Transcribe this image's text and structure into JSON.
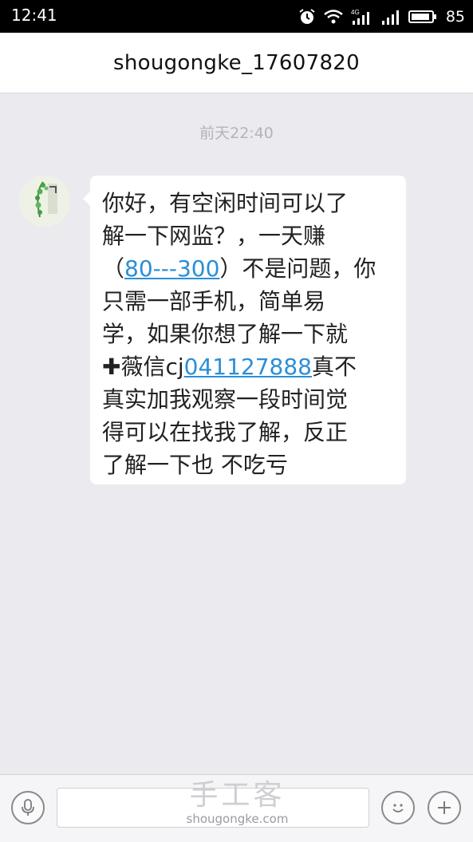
{
  "status_bar": {
    "time": "12:41",
    "battery": "85",
    "icons": [
      "alarm-icon",
      "wifi-icon",
      "signal-4g-icon",
      "signal-icon",
      "battery-icon"
    ]
  },
  "header": {
    "title": "shougongke_17607820"
  },
  "chat": {
    "timestamp": "前天22:40",
    "message": {
      "line1": "你好，有空闲时间可以了",
      "line2": "解一下网监？，一天赚",
      "line3_pre": "（",
      "line3_link": "80---300",
      "line3_post": "）不是问题，你",
      "line4": "只需一部手机，简单易",
      "line5": "学，如果你想了解一下就",
      "line6_pre": "✚薇信cj",
      "line6_link": "041127888",
      "line6_post": "真不",
      "line7": "真实加我观察一段时间觉",
      "line8": "得可以在找我了解，反正",
      "line9": "了解一下也 不吃亏"
    }
  },
  "input_bar": {
    "placeholder": ""
  },
  "watermark": {
    "cn": "手工客",
    "en": "shougongke.com"
  },
  "colors": {
    "link": "#2a8fd6",
    "background": "#ebebef"
  }
}
